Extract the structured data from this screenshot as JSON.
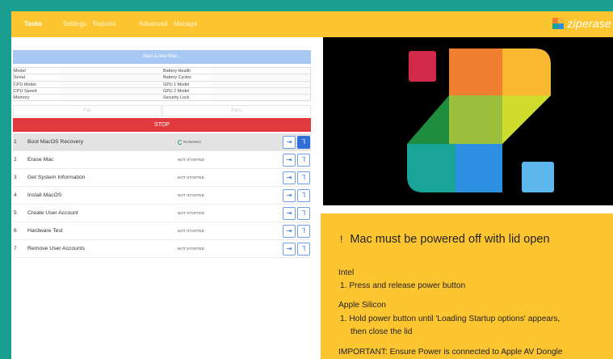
{
  "nav": {
    "items": [
      {
        "label": "Tasks",
        "active": true
      },
      {
        "label": "Settings",
        "active": false
      },
      {
        "label": "Reports",
        "active": false
      },
      {
        "label": "Advanced",
        "active": false
      },
      {
        "label": "Manage",
        "active": false
      }
    ],
    "logo_text": "ziperase",
    "logo_icon": "ziperase-logo-icon"
  },
  "panel": {
    "start_label": "Start a new Mac...",
    "info_left": [
      "Model",
      "Serial",
      "CPU Model",
      "CPU Speed",
      "Memory"
    ],
    "info_right": [
      "Battery Health",
      "Battery Cycles",
      "GPU 1 Model",
      "GPU 2 Model",
      "Security Lock"
    ],
    "fail_label": "Fail",
    "pass_label": "Pass",
    "stop_label": "STOP"
  },
  "tasks": [
    {
      "num": "1",
      "name": "Boot MacOS Recovery",
      "status": "RUNNING",
      "running": true
    },
    {
      "num": "2",
      "name": "Erase Mac",
      "status": "NOT STARTED",
      "running": false
    },
    {
      "num": "3",
      "name": "Get System Information",
      "status": "NOT STARTED",
      "running": false
    },
    {
      "num": "4",
      "name": "Install MacOS",
      "status": "NOT STARTED",
      "running": false
    },
    {
      "num": "5",
      "name": "Create User Account",
      "status": "NOT STARTED",
      "running": false
    },
    {
      "num": "6",
      "name": "Hardware Test",
      "status": "NOT STARTED",
      "running": false
    },
    {
      "num": "7",
      "name": "Remove User Accounts",
      "status": "NOT STARTED",
      "running": false
    }
  ],
  "notice": {
    "icon": "!",
    "title": "Mac must be powered off with lid open",
    "intel_heading": "Intel",
    "intel_step": "1. Press and release power button",
    "silicon_heading": "Apple Silicon",
    "silicon_step_1": "1. Hold power button until 'Loading Startup options' appears,",
    "silicon_step_2": "then close the lid",
    "important": "IMPORTANT: Ensure Power is connected to Apple AV Dongle"
  },
  "colors": {
    "accent_yellow": "#fdc52f",
    "stop_red": "#e03a3f",
    "start_blue": "#a8c8f4",
    "action_blue": "#2f6fd6",
    "frame_teal": "#1a9e8f"
  }
}
